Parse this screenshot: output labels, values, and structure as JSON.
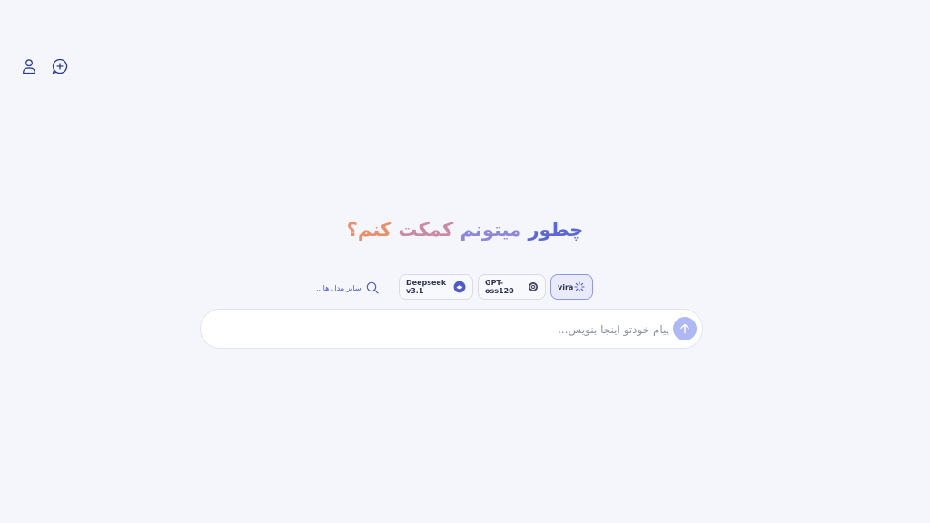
{
  "header": {
    "profile_icon": "user-icon",
    "new_chat_icon": "message-plus-icon"
  },
  "heading": {
    "part1": "چطور",
    "part2": "میتونم",
    "part3": "کمکت",
    "part4": "کنم؟",
    "colors": [
      "#5b68d6",
      "#8e86d9",
      "#c98aa6",
      "#e8906c"
    ]
  },
  "models": {
    "items": [
      {
        "label": "vira",
        "icon": "loader-icon",
        "selected": true
      },
      {
        "label": "GPT-oss120",
        "icon": "openai-icon",
        "selected": false
      },
      {
        "label": "Deepseek v3.1",
        "icon": "deepseek-icon",
        "selected": false
      }
    ],
    "other_label": "سایر مدل ها...",
    "other_icon": "search-icon"
  },
  "composer": {
    "placeholder": "پیام خودتو اینجا بنویس...",
    "value": "",
    "send_icon": "arrow-up-icon"
  },
  "colors": {
    "background": "#f5f6fb",
    "accent": "#4e5bc9",
    "send_button": "#aeb8f5"
  }
}
